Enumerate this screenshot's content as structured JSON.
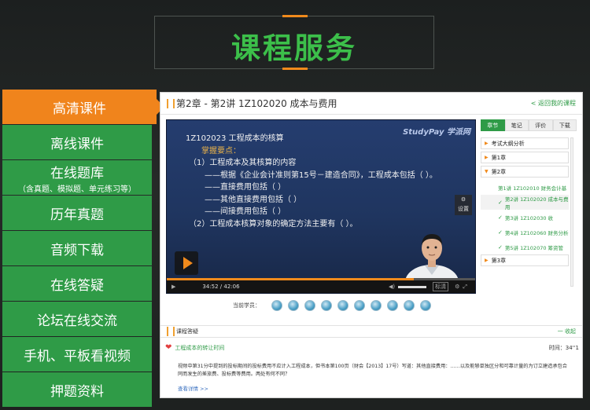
{
  "header": {
    "title": "课程服务"
  },
  "sidebar": {
    "items": [
      {
        "label": "高清课件",
        "sub": ""
      },
      {
        "label": "离线课件",
        "sub": ""
      },
      {
        "label": "在线题库",
        "sub": "（含真题、模拟题、单元练习等）"
      },
      {
        "label": "历年真题",
        "sub": ""
      },
      {
        "label": "音频下载",
        "sub": ""
      },
      {
        "label": "在线答疑",
        "sub": ""
      },
      {
        "label": "论坛在线交流",
        "sub": ""
      },
      {
        "label": "手机、平板看视频",
        "sub": ""
      },
      {
        "label": "押题资料",
        "sub": ""
      }
    ],
    "active_index": 0
  },
  "panel": {
    "title": "第2章 - 第2讲 1Z102020 成本与费用",
    "back_link": "< 返回我的课程"
  },
  "player": {
    "watermark": "StudyPay 学派网",
    "slide": {
      "title": "1Z102023  工程成本的核算",
      "highlight": "掌握要点：",
      "lines": [
        "（1）工程成本及其核算的内容",
        "——根据《企业会计准则第15号－建造合同》，工程成本包括（   ）。",
        "——直接费用包括（   ）",
        "——其他直接费用包括（   ）",
        "——间接费用包括（   ）",
        "（2）工程成本核算对象的确定方法主要有（   ）。"
      ]
    },
    "gear_label": "设置",
    "time_current": "34:52",
    "time_total": "42:06",
    "quality": "标清",
    "progress": 0.8
  },
  "right_panel": {
    "tabs": [
      "章节",
      "笔记",
      "评价",
      "下载"
    ],
    "active_tab": 0,
    "chapters_top": [
      "考试大纲分析",
      "第1章",
      "第2章"
    ],
    "lessons": [
      {
        "label": "第1讲 1Z102010 财务会计基",
        "checked": false
      },
      {
        "label": "第2讲 1Z102020 成本与费用",
        "checked": true
      },
      {
        "label": "第3讲 1Z102030 收",
        "checked": true
      },
      {
        "label": "第4讲 1Z102060 财务分析",
        "checked": true
      },
      {
        "label": "第5讲 1Z102070 筹资管",
        "checked": true
      }
    ],
    "chapter_bottom": "第3章"
  },
  "learners": {
    "label": "当前学员：",
    "count": 10
  },
  "qa": {
    "section_title": "课程答疑",
    "collapse": "一  收起",
    "question": "工程成本的转让时间",
    "time": "时间：34''1",
    "body": "视频中第31分中提到的投标期间的投标费用不应计入工程成本，但书本第100页（财会【2013】17号）写道：其他直接费用：……以及能够单独区分和可靠计量的为订立建造承包合同而发生的差旅费、投标费等费用。两处有何不同？",
    "more": "查看详情 >>"
  }
}
